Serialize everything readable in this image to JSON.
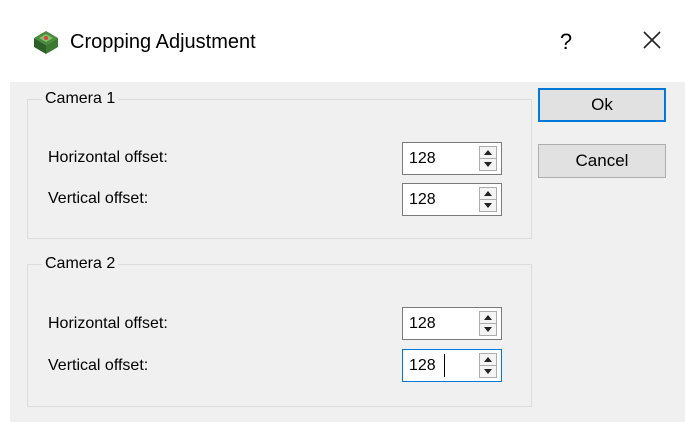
{
  "window": {
    "title": "Cropping Adjustment",
    "help_label": "?",
    "icon": "app-icon",
    "close_icon": "close-icon"
  },
  "cameras": [
    {
      "title": "Camera 1",
      "horizontal": {
        "label": "Horizontal offset:",
        "value": "128"
      },
      "vertical": {
        "label": "Vertical offset:",
        "value": "128"
      }
    },
    {
      "title": "Camera 2",
      "horizontal": {
        "label": "Horizontal offset:",
        "value": "128"
      },
      "vertical": {
        "label": "Vertical offset:",
        "value": "128"
      }
    }
  ],
  "buttons": {
    "ok_label": "Ok",
    "cancel_label": "Cancel"
  },
  "colors": {
    "focus_accent": "#0078d7",
    "dialog_background": "#f0f0f0"
  }
}
